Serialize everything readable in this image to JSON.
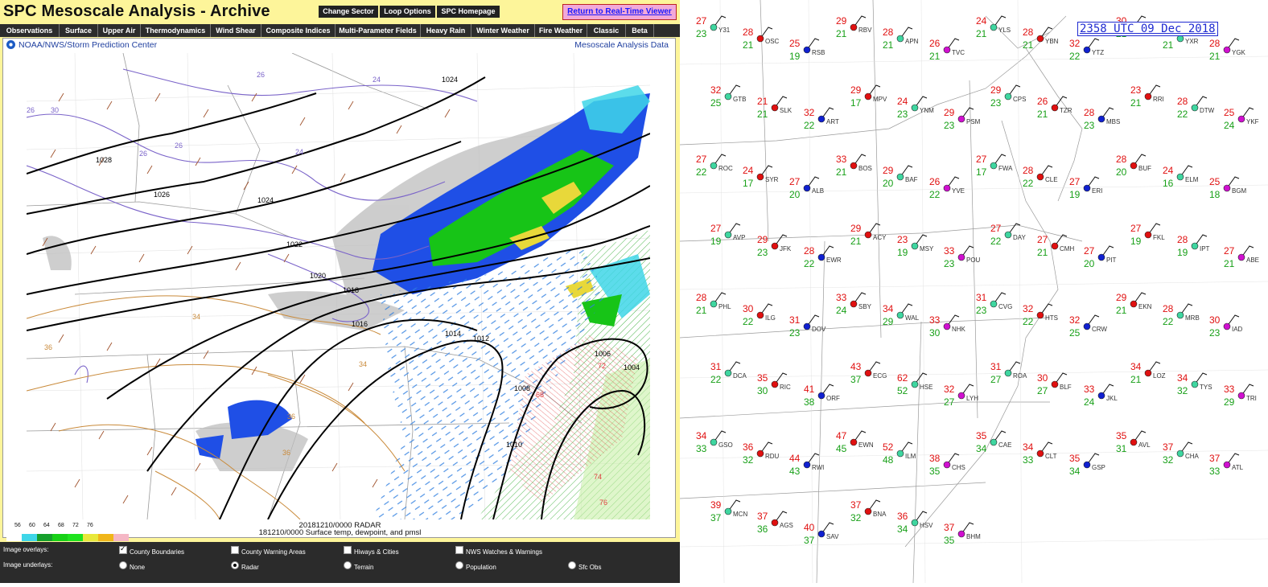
{
  "page_title": "SPC Mesoscale Analysis - Archive",
  "top_buttons": [
    "Change Sector",
    "Loop Options",
    "SPC Homepage"
  ],
  "realtime_link": "Return to Real-Time Viewer",
  "menu": [
    "Observations",
    "Surface",
    "Upper Air",
    "Thermodynamics",
    "Wind Shear",
    "Composite Indices",
    "Multi-Parameter Fields",
    "Heavy Rain",
    "Winter Weather",
    "Fire Weather",
    "Classic",
    "Beta"
  ],
  "credit": "NOAA/NWS/Storm Prediction Center",
  "data_link": "Mesoscale Analysis Data",
  "caption_radar": "20181210/0000 RADAR",
  "caption_field": "181210/0000 Surface temp, dewpoint, and pmsl",
  "legend": {
    "labels": [
      "56",
      "60",
      "64",
      "68",
      "72",
      "76"
    ],
    "colors": [
      "#ffffff",
      "#3fd6e8",
      "#16a02c",
      "#17d117",
      "#1fe31f",
      "#e8e83a",
      "#f0b61a",
      "#f5b7c5"
    ]
  },
  "overlays_label": "Image overlays:",
  "underlays_label": "Image underlays:",
  "overlays": [
    {
      "label": "County Boundaries",
      "checked": true
    },
    {
      "label": "County Warning Areas",
      "checked": false
    },
    {
      "label": "Hiways & Cities",
      "checked": false
    },
    {
      "label": "NWS Watches & Warnings",
      "checked": false
    }
  ],
  "underlays": [
    {
      "label": "None",
      "selected": false
    },
    {
      "label": "Radar",
      "selected": true
    },
    {
      "label": "Terrain",
      "selected": false
    },
    {
      "label": "Population",
      "selected": false
    },
    {
      "label": "Sfc Obs",
      "selected": false
    }
  ],
  "isobars": [
    "1028",
    "1026",
    "1024",
    "1022",
    "1020",
    "1018",
    "1016",
    "1014",
    "1012",
    "1010",
    "1008",
    "1006",
    "1004",
    "1024"
  ],
  "dewpoint_labels": [
    "30",
    "26",
    "26",
    "26",
    "24",
    "24",
    "26",
    "34",
    "36",
    "34",
    "36",
    "36"
  ],
  "temp_labels": [
    "72",
    "68",
    "74",
    "76"
  ],
  "obs_timestamp": "2358 UTC 09 Dec 2018",
  "station_plots": [
    [
      "Y31",
      "27",
      "23"
    ],
    [
      "OSC",
      "28",
      "21"
    ],
    [
      "RSB",
      "25",
      "19"
    ],
    [
      "RBV",
      "29",
      "21"
    ],
    [
      "APN",
      "28",
      "21"
    ],
    [
      "TVC",
      "26",
      "21"
    ],
    [
      "YLS",
      "24",
      "21"
    ],
    [
      "YBN",
      "28",
      "21"
    ],
    [
      "YTZ",
      "32",
      "22"
    ],
    [
      "YOO",
      "30",
      "21"
    ],
    [
      "YXR",
      "32",
      "21"
    ],
    [
      "YGK",
      "28",
      "21"
    ],
    [
      "GTB",
      "32",
      "25"
    ],
    [
      "SLK",
      "21",
      "21"
    ],
    [
      "ART",
      "32",
      "22"
    ],
    [
      "MPV",
      "29",
      "17"
    ],
    [
      "YNM",
      "24",
      "23"
    ],
    [
      "PSM",
      "29",
      "23"
    ],
    [
      "CPS",
      "29",
      "23"
    ],
    [
      "TZR",
      "26",
      "21"
    ],
    [
      "MBS",
      "28",
      "23"
    ],
    [
      "RRI",
      "23",
      "21"
    ],
    [
      "DTW",
      "28",
      "22"
    ],
    [
      "YKF",
      "25",
      "24"
    ],
    [
      "ROC",
      "27",
      "22"
    ],
    [
      "SYR",
      "24",
      "17"
    ],
    [
      "ALB",
      "27",
      "20"
    ],
    [
      "BOS",
      "33",
      "21"
    ],
    [
      "BAF",
      "29",
      "20"
    ],
    [
      "YVE",
      "26",
      "22"
    ],
    [
      "FWA",
      "27",
      "17"
    ],
    [
      "CLE",
      "28",
      "22"
    ],
    [
      "ERI",
      "27",
      "19"
    ],
    [
      "BUF",
      "28",
      "20"
    ],
    [
      "ELM",
      "24",
      "16"
    ],
    [
      "BGM",
      "25",
      "18"
    ],
    [
      "AVP",
      "27",
      "19"
    ],
    [
      "JFK",
      "29",
      "23"
    ],
    [
      "EWR",
      "28",
      "22"
    ],
    [
      "ACY",
      "29",
      "21"
    ],
    [
      "MSY",
      "23",
      "19"
    ],
    [
      "POU",
      "33",
      "23"
    ],
    [
      "DAY",
      "27",
      "22"
    ],
    [
      "CMH",
      "27",
      "21"
    ],
    [
      "PIT",
      "27",
      "20"
    ],
    [
      "FKL",
      "27",
      "19"
    ],
    [
      "IPT",
      "28",
      "19"
    ],
    [
      "ABE",
      "27",
      "21"
    ],
    [
      "PHL",
      "28",
      "21"
    ],
    [
      "ILG",
      "30",
      "22"
    ],
    [
      "DOV",
      "31",
      "23"
    ],
    [
      "SBY",
      "33",
      "24"
    ],
    [
      "WAL",
      "34",
      "29"
    ],
    [
      "NHK",
      "33",
      "30"
    ],
    [
      "CVG",
      "31",
      "23"
    ],
    [
      "HTS",
      "32",
      "22"
    ],
    [
      "CRW",
      "32",
      "25"
    ],
    [
      "EKN",
      "29",
      "21"
    ],
    [
      "MRB",
      "28",
      "22"
    ],
    [
      "IAD",
      "30",
      "23"
    ],
    [
      "DCA",
      "31",
      "22"
    ],
    [
      "RIC",
      "35",
      "30"
    ],
    [
      "ORF",
      "41",
      "38"
    ],
    [
      "ECG",
      "43",
      "37"
    ],
    [
      "HSE",
      "62",
      "52"
    ],
    [
      "LYH",
      "32",
      "27"
    ],
    [
      "ROA",
      "31",
      "27"
    ],
    [
      "BLF",
      "30",
      "27"
    ],
    [
      "JKL",
      "33",
      "24"
    ],
    [
      "LOZ",
      "34",
      "21"
    ],
    [
      "TYS",
      "34",
      "32"
    ],
    [
      "TRI",
      "33",
      "29"
    ],
    [
      "GSO",
      "34",
      "33"
    ],
    [
      "RDU",
      "36",
      "32"
    ],
    [
      "RWI",
      "44",
      "43"
    ],
    [
      "EWN",
      "47",
      "45"
    ],
    [
      "ILM",
      "52",
      "48"
    ],
    [
      "CHS",
      "38",
      "35"
    ],
    [
      "CAE",
      "35",
      "34"
    ],
    [
      "CLT",
      "34",
      "33"
    ],
    [
      "GSP",
      "35",
      "34"
    ],
    [
      "AVL",
      "35",
      "31"
    ],
    [
      "CHA",
      "37",
      "32"
    ],
    [
      "ATL",
      "37",
      "33"
    ],
    [
      "MCN",
      "39",
      "37"
    ],
    [
      "AGS",
      "37",
      "36"
    ],
    [
      "SAV",
      "40",
      "37"
    ],
    [
      "BNA",
      "37",
      "32"
    ],
    [
      "HSV",
      "36",
      "34"
    ],
    [
      "BHM",
      "37",
      "35"
    ]
  ]
}
